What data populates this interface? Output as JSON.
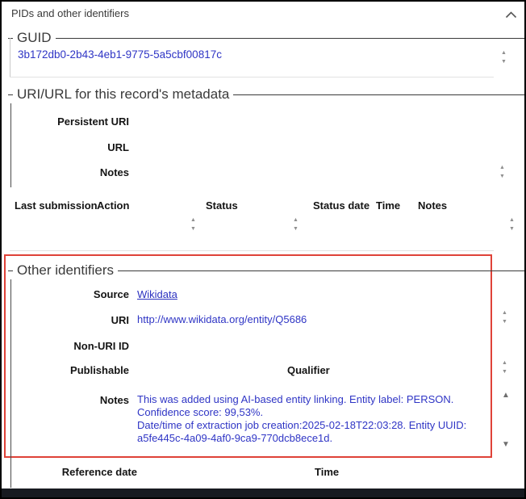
{
  "header": {
    "title": "PIDs and other identifiers"
  },
  "icons": {
    "up": "▲",
    "down": "▼",
    "chevron_collapse": "chevron-up"
  },
  "colors": {
    "accent_red": "#df4238",
    "value_blue": "#2f35c5",
    "link_blue": "#2b31c0",
    "bottom_bar": "#171a20"
  },
  "sections": {
    "guid": {
      "legend": "GUID",
      "value": "3b172db0-2b43-4eb1-9775-5a5cbf00817c"
    },
    "uri_url": {
      "legend": "URI/URL for this record's metadata",
      "labels": {
        "persistent_uri": "Persistent URI",
        "url": "URL",
        "notes": "Notes"
      }
    },
    "other_identifiers": {
      "legend": "Other identifiers",
      "source_label": "Source",
      "source_value": "Wikidata",
      "uri_label": "URI",
      "uri_value": "http://www.wikidata.org/entity/Q5686",
      "non_uri_id_label": "Non-URI ID",
      "publishable_label": "Publishable",
      "qualifier_label": "Qualifier",
      "notes_label": "Notes",
      "notes_value": "This was added using AI-based entity linking. Entity label: PERSON.\nConfidence score: 99,53%.\nDate/time of extraction job creation:2025-02-18T22:03:28. Entity UUID: a5fe445c-4a09-4af0-9ca9-770dcb8ece1d."
    }
  },
  "submission": {
    "headers": [
      "Last submission",
      "Action",
      "Status",
      "Status date",
      "Time",
      "Notes"
    ]
  },
  "footer": {
    "reference_date_label": "Reference date",
    "time_label": "Time"
  }
}
